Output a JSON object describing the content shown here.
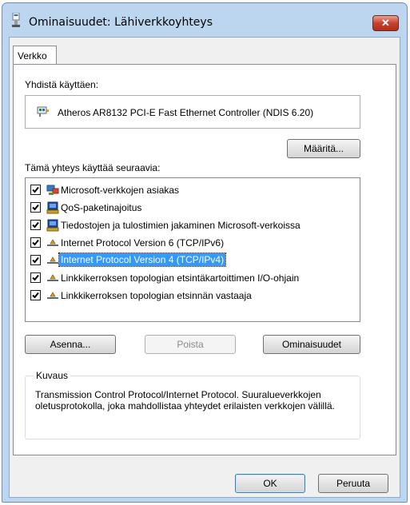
{
  "window": {
    "title": "Ominaisuudet: Lähiverkkoyhteys",
    "close_label": "✕"
  },
  "tabs": [
    {
      "label": "Verkko"
    }
  ],
  "connect_using": {
    "label": "Yhdistä käyttäen:",
    "adapter": "Atheros AR8132 PCI-E Fast Ethernet Controller (NDIS 6.20)",
    "configure_button": "Määritä..."
  },
  "components": {
    "label": "Tämä yhteys käyttää seuraavia:",
    "items": [
      {
        "label": "Microsoft-verkkojen asiakas",
        "checked": true,
        "icon": "network-client-icon"
      },
      {
        "label": "QoS-paketinajoitus",
        "checked": true,
        "icon": "network-service-icon"
      },
      {
        "label": "Tiedostojen ja tulostimien jakaminen Microsoft-verkoissa",
        "checked": true,
        "icon": "network-service-icon"
      },
      {
        "label": "Internet Protocol Version 6 (TCP/IPv6)",
        "checked": true,
        "icon": "protocol-icon"
      },
      {
        "label": "Internet Protocol Version 4 (TCP/IPv4)",
        "checked": true,
        "icon": "protocol-icon",
        "selected": true
      },
      {
        "label": "Linkkikerroksen topologian etsintäkartoittimen I/O-ohjain",
        "checked": true,
        "icon": "protocol-icon"
      },
      {
        "label": "Linkkikerroksen topologian etsinnän vastaaja",
        "checked": true,
        "icon": "protocol-icon"
      }
    ]
  },
  "buttons": {
    "install": "Asenna...",
    "uninstall": "Poista",
    "properties": "Ominaisuudet"
  },
  "description": {
    "legend": "Kuvaus",
    "text": "Transmission Control Protocol/Internet Protocol. Suuralueverkkojen oletusprotokolla, joka mahdollistaa yhteydet erilaisten verkkojen välillä."
  },
  "footer": {
    "ok": "OK",
    "cancel": "Peruuta"
  }
}
